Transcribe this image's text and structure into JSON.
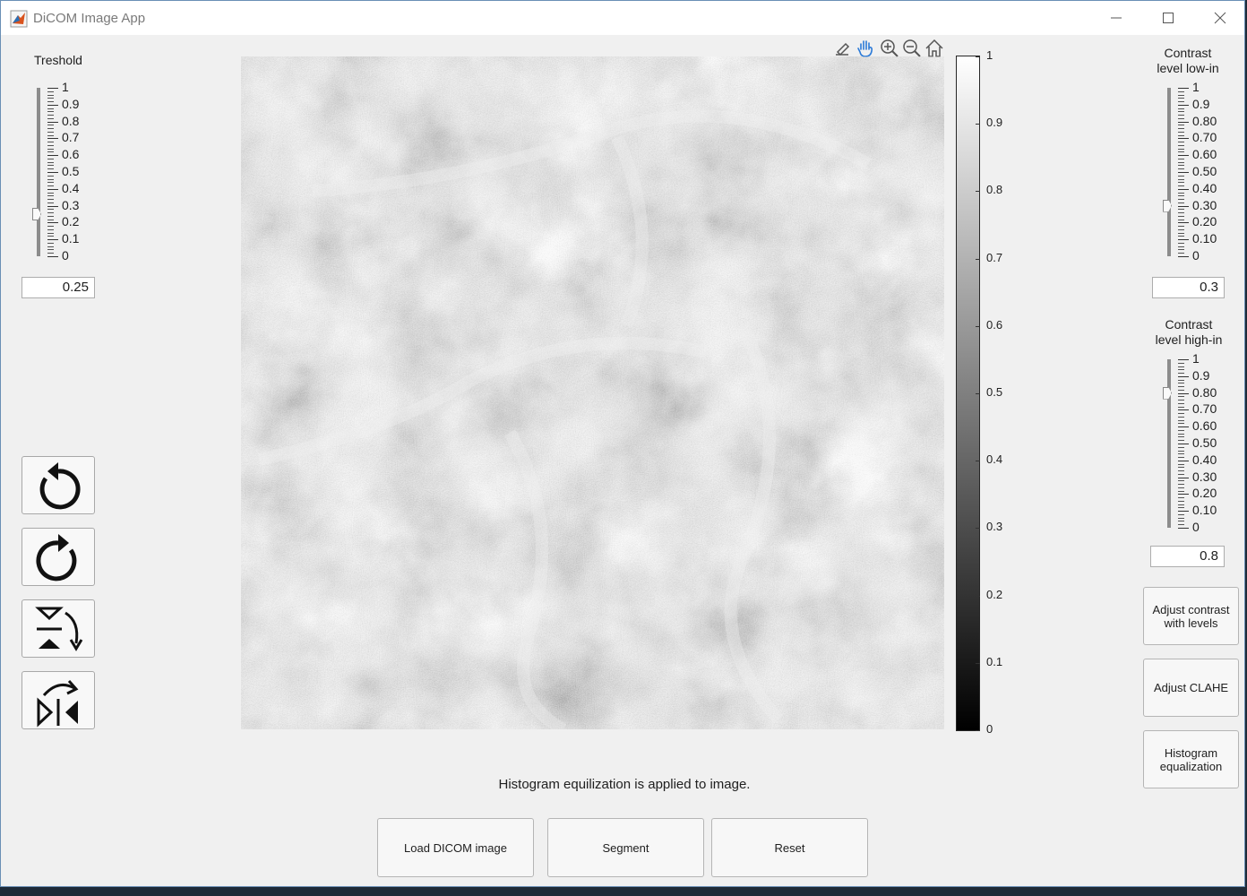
{
  "window": {
    "title": "DiCOM Image App",
    "controls": [
      "minimize-icon",
      "maximize-icon",
      "close-icon"
    ]
  },
  "threshold": {
    "label": "Treshold",
    "ticks": [
      "1",
      "0.9",
      "0.8",
      "0.7",
      "0.6",
      "0.5",
      "0.4",
      "0.3",
      "0.2",
      "0.1",
      "0"
    ],
    "value": "0.25"
  },
  "contrast_low": {
    "label": "Contrast\nlevel low-in",
    "ticks": [
      "1",
      "0.9",
      "0.80",
      "0.70",
      "0.60",
      "0.50",
      "0.40",
      "0.30",
      "0.20",
      "0.10",
      "0"
    ],
    "value": "0.3"
  },
  "contrast_high": {
    "label": "Contrast\nlevel high-in",
    "ticks": [
      "1",
      "0.9",
      "0.80",
      "0.70",
      "0.60",
      "0.50",
      "0.40",
      "0.30",
      "0.20",
      "0.10",
      "0"
    ],
    "value": "0.8"
  },
  "toolbar": {
    "icons": [
      "brush-icon",
      "pan-hand-icon",
      "zoom-in-icon",
      "zoom-out-icon",
      "home-icon"
    ]
  },
  "colorbar": {
    "ticks": [
      "1",
      "0.9",
      "0.8",
      "0.7",
      "0.6",
      "0.5",
      "0.4",
      "0.3",
      "0.2",
      "0.1",
      "0"
    ]
  },
  "left_tools": [
    "rotate-left-icon",
    "rotate-right-icon",
    "flip-vertical-icon",
    "flip-horizontal-icon"
  ],
  "right_buttons": {
    "adjust_levels": "Adjust contrast\nwith levels",
    "adjust_clahe": "Adjust CLAHE",
    "histeq": "Histogram\nequalization"
  },
  "status": "Histogram equilization is applied to image.",
  "bottom_buttons": {
    "load": "Load DICOM image",
    "segment": "Segment",
    "reset": "Reset"
  },
  "colors": {
    "window_bg": "#f0f0f0",
    "image_gray": "#9a9a9a",
    "accent": "#0078d7"
  }
}
